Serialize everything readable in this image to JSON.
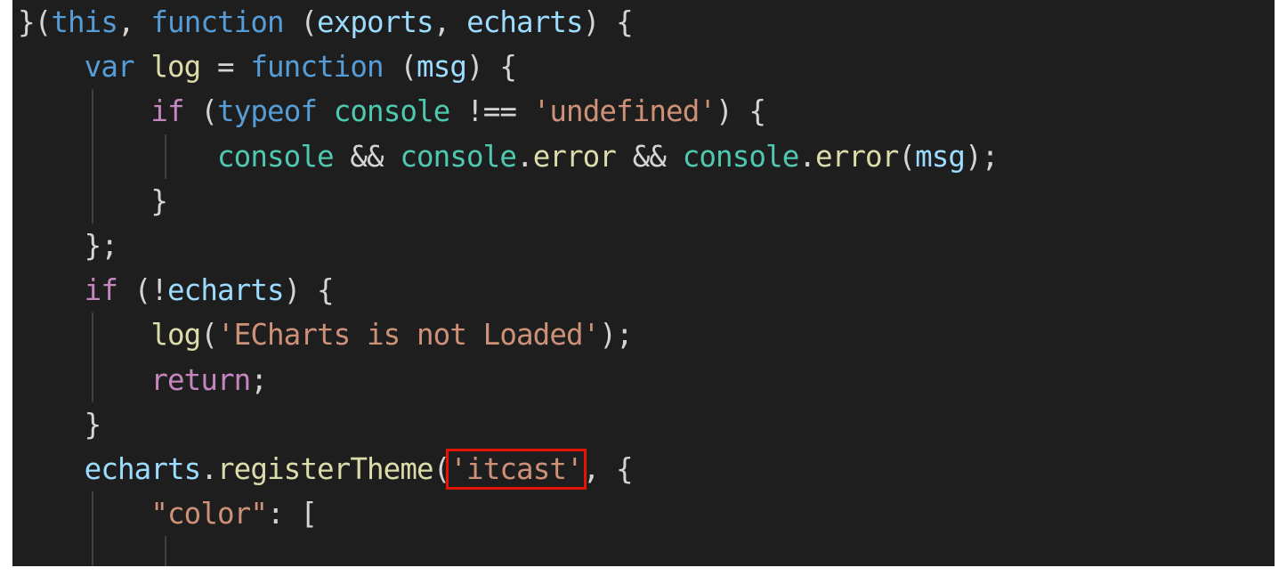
{
  "theme": {
    "background": "#1e1e1e",
    "keyword": "#569cd6",
    "control": "#c586c0",
    "function": "#dcdcaa",
    "variable": "#9cdcfe",
    "class": "#4ec9b0",
    "string": "#ce9178",
    "highlight_box": "#e51400"
  },
  "lines": [
    [
      {
        "t": "}(",
        "c": "pl"
      },
      {
        "t": "this",
        "c": "kw"
      },
      {
        "t": ", ",
        "c": "pl"
      },
      {
        "t": "function",
        "c": "kw"
      },
      {
        "t": " (",
        "c": "pl"
      },
      {
        "t": "exports",
        "c": "var"
      },
      {
        "t": ", ",
        "c": "pl"
      },
      {
        "t": "echarts",
        "c": "var"
      },
      {
        "t": ") {",
        "c": "pl"
      }
    ],
    [
      {
        "t": "    ",
        "c": "pl"
      },
      {
        "t": "var",
        "c": "kw"
      },
      {
        "t": " ",
        "c": "pl"
      },
      {
        "t": "log",
        "c": "fn"
      },
      {
        "t": " = ",
        "c": "pl"
      },
      {
        "t": "function",
        "c": "kw"
      },
      {
        "t": " (",
        "c": "pl"
      },
      {
        "t": "msg",
        "c": "var"
      },
      {
        "t": ") {",
        "c": "pl"
      }
    ],
    [
      {
        "t": "        ",
        "c": "pl"
      },
      {
        "t": "if",
        "c": "ctl"
      },
      {
        "t": " (",
        "c": "pl"
      },
      {
        "t": "typeof",
        "c": "kw"
      },
      {
        "t": " ",
        "c": "pl"
      },
      {
        "t": "console",
        "c": "cls"
      },
      {
        "t": " !== ",
        "c": "pl"
      },
      {
        "t": "'undefined'",
        "c": "str"
      },
      {
        "t": ") {",
        "c": "pl"
      }
    ],
    [
      {
        "t": "            ",
        "c": "pl"
      },
      {
        "t": "console",
        "c": "cls"
      },
      {
        "t": " && ",
        "c": "pl"
      },
      {
        "t": "console",
        "c": "cls"
      },
      {
        "t": ".",
        "c": "pl"
      },
      {
        "t": "error",
        "c": "fn"
      },
      {
        "t": " && ",
        "c": "pl"
      },
      {
        "t": "console",
        "c": "cls"
      },
      {
        "t": ".",
        "c": "pl"
      },
      {
        "t": "error",
        "c": "fn"
      },
      {
        "t": "(",
        "c": "pl"
      },
      {
        "t": "msg",
        "c": "var"
      },
      {
        "t": ");",
        "c": "pl"
      }
    ],
    [
      {
        "t": "        }",
        "c": "pl"
      }
    ],
    [
      {
        "t": "    };",
        "c": "pl"
      }
    ],
    [
      {
        "t": "    ",
        "c": "pl"
      },
      {
        "t": "if",
        "c": "ctl"
      },
      {
        "t": " (!",
        "c": "pl"
      },
      {
        "t": "echarts",
        "c": "var"
      },
      {
        "t": ") {",
        "c": "pl"
      }
    ],
    [
      {
        "t": "        ",
        "c": "pl"
      },
      {
        "t": "log",
        "c": "fn"
      },
      {
        "t": "(",
        "c": "pl"
      },
      {
        "t": "'ECharts is not Loaded'",
        "c": "str"
      },
      {
        "t": ");",
        "c": "pl"
      }
    ],
    [
      {
        "t": "        ",
        "c": "pl"
      },
      {
        "t": "return",
        "c": "ctl"
      },
      {
        "t": ";",
        "c": "pl"
      }
    ],
    [
      {
        "t": "    }",
        "c": "pl"
      }
    ],
    [
      {
        "t": "    ",
        "c": "pl"
      },
      {
        "t": "echarts",
        "c": "var"
      },
      {
        "t": ".",
        "c": "pl"
      },
      {
        "t": "registerTheme",
        "c": "fn"
      },
      {
        "t": "(",
        "c": "pl"
      },
      {
        "t": "'itcast'",
        "c": "str",
        "highlight": true
      },
      {
        "t": ", {",
        "c": "pl"
      }
    ],
    [
      {
        "t": "        ",
        "c": "pl"
      },
      {
        "t": "\"color\"",
        "c": "str"
      },
      {
        "t": ": [",
        "c": "pl"
      }
    ]
  ],
  "guides": [
    [],
    [],
    [
      1
    ],
    [
      1,
      2
    ],
    [
      1
    ],
    [],
    [],
    [
      1
    ],
    [
      1
    ],
    [],
    [],
    [
      1
    ],
    [
      1,
      2
    ]
  ]
}
